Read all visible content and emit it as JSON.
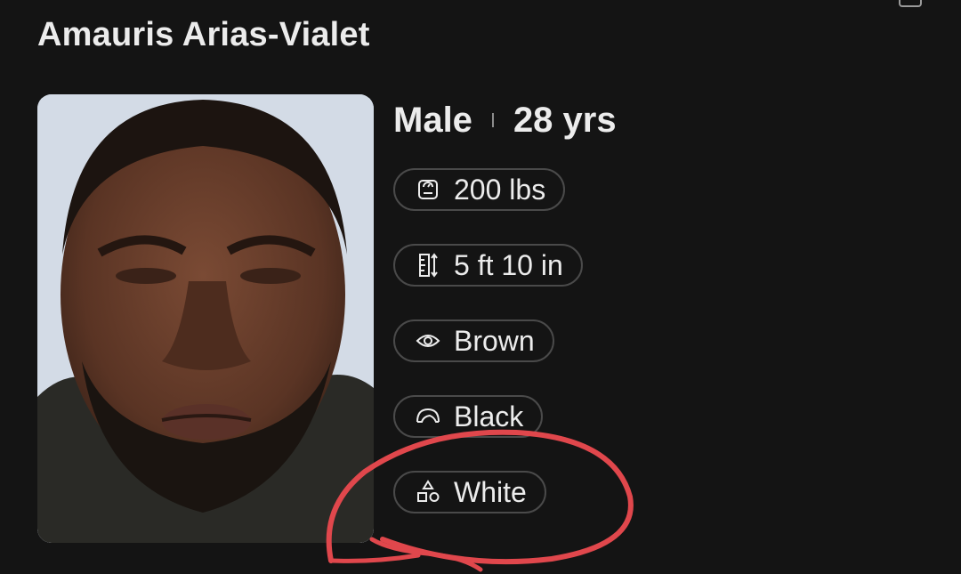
{
  "profile": {
    "name": "Amauris Arias-Vialet",
    "gender": "Male",
    "age": "28 yrs",
    "photo_icon": "person-photo"
  },
  "attributes": [
    {
      "key": "weight",
      "icon": "scale-icon",
      "label": "200 lbs"
    },
    {
      "key": "height",
      "icon": "ruler-icon",
      "label": "5 ft 10 in"
    },
    {
      "key": "eyes",
      "icon": "eye-icon",
      "label": "Brown"
    },
    {
      "key": "hair",
      "icon": "hair-icon",
      "label": "Black"
    },
    {
      "key": "race",
      "icon": "shapes-icon",
      "label": "White"
    }
  ],
  "colors": {
    "background": "#141414",
    "text": "#ececec",
    "chip_border": "#4a4a4a",
    "annotation": "#e0474c"
  }
}
